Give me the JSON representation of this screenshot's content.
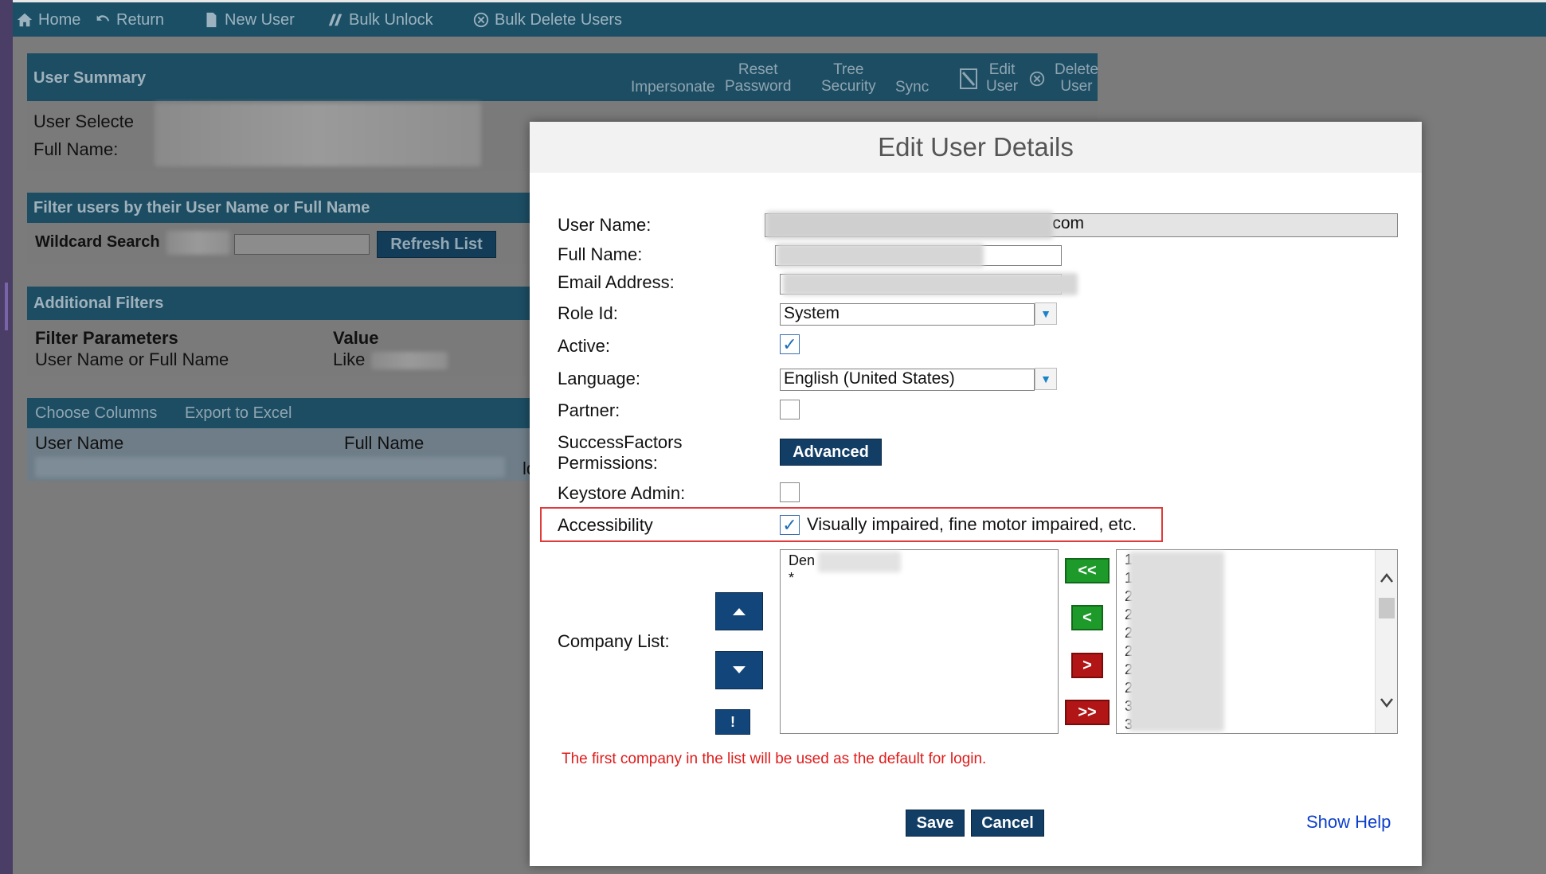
{
  "toolbar": {
    "items": [
      {
        "label": "Home",
        "icon": "home-icon"
      },
      {
        "label": "Return",
        "icon": "return-icon"
      },
      {
        "label": "New User",
        "icon": "document-icon"
      },
      {
        "label": "Bulk Unlock",
        "icon": "unlock-icon"
      },
      {
        "label": "Bulk Delete Users",
        "icon": "circle-x-icon"
      }
    ]
  },
  "user_summary": {
    "title": "User Summary",
    "actions": {
      "impersonate": "Impersonate",
      "reset_password_1": "Reset",
      "reset_password_2": "Password",
      "tree_security_1": "Tree",
      "tree_security_2": "Security",
      "sync": "Sync",
      "edit_user_1": "Edit",
      "edit_user_2": "User",
      "delete_user_1": "Delete",
      "delete_user_2": "User"
    },
    "user_selected_label": "User Selecte",
    "full_name_label": "Full Name:"
  },
  "filter_panel": {
    "title": "Filter users by their User Name or Full Name",
    "wildcard_label": "Wildcard Search",
    "refresh_label": "Refresh List"
  },
  "additional_filters": {
    "title": "Additional Filters",
    "col_param": "Filter Parameters",
    "col_value": "Value",
    "row_param": "User Name or Full Name",
    "row_value": "Like"
  },
  "results": {
    "choose_columns": "Choose Columns",
    "export": "Export to Excel",
    "col_user_name": "User Name",
    "col_full_name": "Full Name",
    "trailing": "ldc"
  },
  "dialog": {
    "title": "Edit User Details",
    "labels": {
      "user_name": "User Name:",
      "full_name": "Full Name:",
      "email": "Email Address:",
      "role_id": "Role Id:",
      "active": "Active:",
      "language": "Language:",
      "partner": "Partner:",
      "sf_permissions_1": "SuccessFactors",
      "sf_permissions_2": "Permissions:",
      "keystore_admin": "Keystore Admin:",
      "accessibility": "Accessibility",
      "company_list": "Company List:"
    },
    "user_name_suffix": "com",
    "role_value": "System",
    "language_value": "English (United States)",
    "active_checked": true,
    "partner_checked": false,
    "keystore_checked": false,
    "accessibility_checked": true,
    "accessibility_text": "Visually impaired, fine motor impaired, etc.",
    "advanced_label": "Advanced",
    "left_list": [
      "Den",
      "*"
    ],
    "right_list": [
      "1",
      "1",
      "2",
      "2",
      "2",
      "2",
      "2",
      "2",
      "3",
      "3"
    ],
    "move_all_left": "<<",
    "move_left": "<",
    "move_right": ">",
    "move_all_right": ">>",
    "bang_label": "!",
    "note": "The first company in the list will be used as the default for login.",
    "save_label": "Save",
    "cancel_label": "Cancel",
    "help_label": "Show Help"
  }
}
